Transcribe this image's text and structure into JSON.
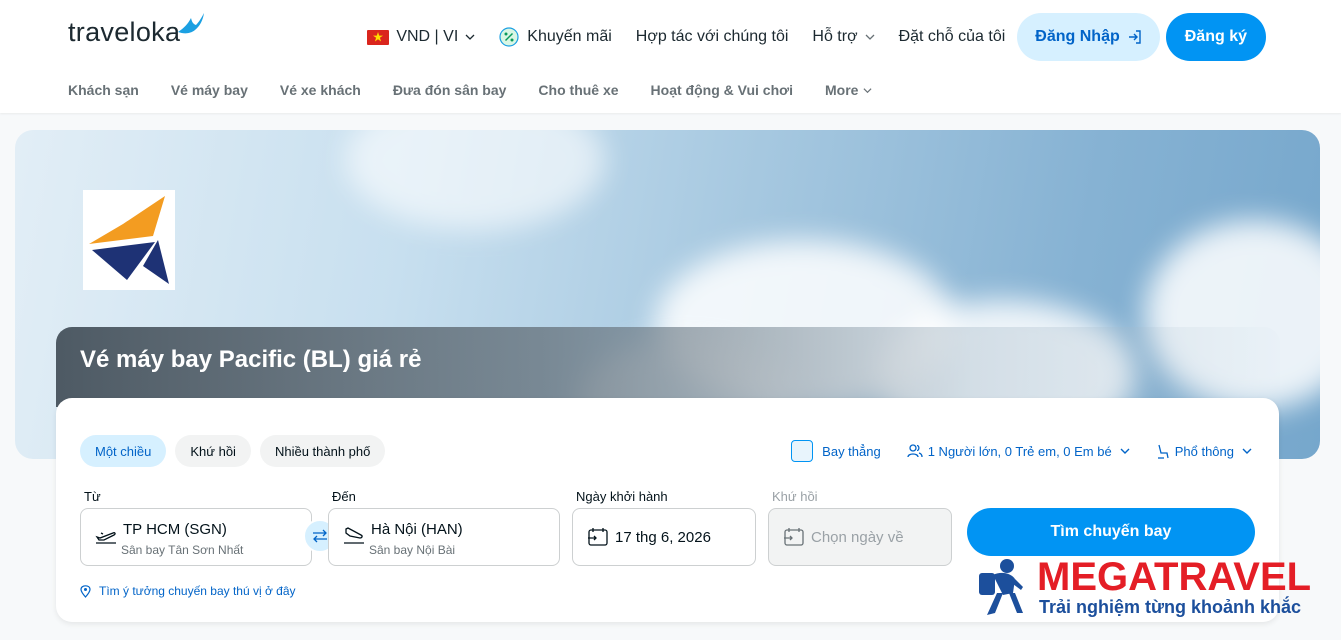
{
  "header": {
    "logo_text": "traveloka",
    "currency": "VND | VI",
    "promo": "Khuyến mãi",
    "partner": "Hợp tác với chúng tôi",
    "support": "Hỗ trợ",
    "my_booking": "Đặt chỗ của tôi",
    "login": "Đăng Nhập",
    "register": "Đăng ký"
  },
  "subnav": {
    "items": [
      "Khách sạn",
      "Vé máy bay",
      "Vé xe khách",
      "Đưa đón sân bay",
      "Cho thuê xe",
      "Hoạt động & Vui chơi"
    ],
    "more": "More"
  },
  "hero": {
    "title": "Vé máy bay Pacific (BL) giá rẻ"
  },
  "search": {
    "trip_types": [
      "Một chiều",
      "Khứ hồi",
      "Nhiều thành phố"
    ],
    "active_trip": "Một chiều",
    "direct": "Bay thẳng",
    "passengers": "1 Người lớn, 0 Trẻ em, 0 Em bé",
    "cabin": "Phổ thông",
    "from_label": "Từ",
    "from_city": "TP HCM (SGN)",
    "from_airport": "Sân bay Tân Sơn Nhất",
    "to_label": "Đến",
    "to_city": "Hà Nội (HAN)",
    "to_airport": "Sân bay Nội Bài",
    "depart_label": "Ngày khởi hành",
    "depart_date": "17 thg 6, 2026",
    "return_label": "Khứ hồi",
    "return_placeholder": "Chọn ngày về",
    "search_button": "Tìm chuyến bay",
    "ideas_link": "Tìm ý tưởng chuyến bay thú vị ở đây"
  },
  "watermark": {
    "brand": "MEGATRAVEL",
    "slogan": "Trải nghiệm từng khoảnh khắc"
  },
  "colors": {
    "primary": "#0194f3",
    "primary_dark": "#0264c8",
    "primary_light": "#d6f0ff",
    "watermark_red": "#e41e26",
    "watermark_blue": "#1c4f9c"
  }
}
